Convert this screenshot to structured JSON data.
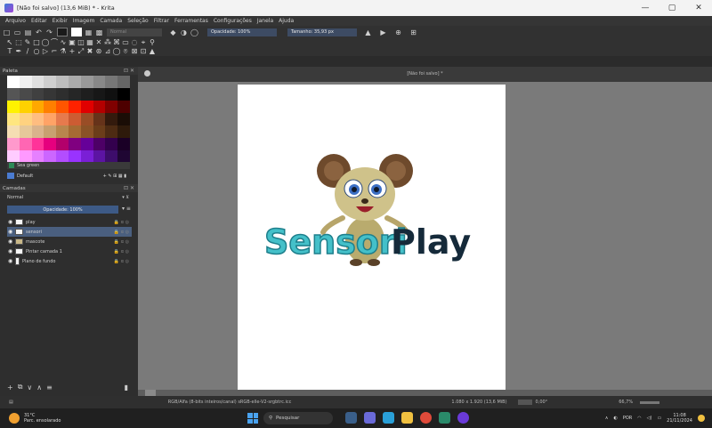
{
  "window": {
    "title": "[Não foi salvo]  (13,6 MiB)  * - Krita",
    "minimize": "—",
    "maximize": "▢",
    "close": "✕"
  },
  "menu": [
    "Arquivo",
    "Editar",
    "Exibir",
    "Imagem",
    "Camada",
    "Seleção",
    "Filtrar",
    "Ferramentas",
    "Configurações",
    "Janela",
    "Ajuda"
  ],
  "toolbar": {
    "blend_mode": "Normal",
    "opacity": "Opacidade: 100%",
    "size": "Tamanho: 35,93 px",
    "fg_color": "#1a1a1a",
    "bg_color": "#ffffff"
  },
  "tools_row1": [
    "↖",
    "⬚",
    "✎",
    "□",
    "◯",
    "⌒",
    "∿",
    "▣",
    "◫",
    "▦",
    "✕",
    "⁂",
    "⌘",
    "▭",
    "◌",
    "⌖",
    "⚲"
  ],
  "tools_row2": [
    "T",
    "✒",
    "/",
    "○",
    "▷",
    "⌐",
    "⚗",
    "+",
    "⤢",
    "✖",
    "⊛",
    "⊿",
    "◯",
    "⌾",
    "⊠",
    "⊡",
    "▲"
  ],
  "palette": {
    "title": "Paleta",
    "rows": [
      [
        "#ffffff",
        "#f0f0f0",
        "#e0e0e0",
        "#cfcfcf",
        "#bdbdbd",
        "#ababab",
        "#999999",
        "#888888",
        "#777777",
        "#666666"
      ],
      [
        "#555555",
        "#4a4a4a",
        "#404040",
        "#363636",
        "#2e2e2e",
        "#262626",
        "#1e1e1e",
        "#171717",
        "#101010",
        "#000000"
      ],
      [
        "#fff200",
        "#ffd100",
        "#ffa800",
        "#ff7f00",
        "#ff5500",
        "#ff2200",
        "#e00000",
        "#b30000",
        "#800000",
        "#4d0000"
      ],
      [
        "#ffe680",
        "#ffd280",
        "#ffbd80",
        "#ffa366",
        "#e67a4d",
        "#cc5c33",
        "#994d26",
        "#66331a",
        "#331a0d",
        "#1a0d06"
      ],
      [
        "#f5deb3",
        "#e6c89a",
        "#d9b38c",
        "#c8a070",
        "#b8864d",
        "#a66b33",
        "#8a5226",
        "#6b3d1a",
        "#4d2b13",
        "#2e1a0b"
      ],
      [
        "#ff99cc",
        "#ff66b3",
        "#ff3399",
        "#e6007e",
        "#b3006b",
        "#800080",
        "#660099",
        "#4d0066",
        "#33004d",
        "#1a0026"
      ],
      [
        "#ffccff",
        "#ff99ff",
        "#e680ff",
        "#cc66ff",
        "#b34dff",
        "#9933ff",
        "#7a1fd6",
        "#5c14a3",
        "#3d0d6b",
        "#1f0633"
      ]
    ],
    "selected_color_name": "Sea green",
    "palette_name": "Default"
  },
  "layers": {
    "title": "Camadas",
    "blend_mode": "Normal",
    "opacity": "Opacidade: 100%",
    "items": [
      {
        "name": "play",
        "active": false
      },
      {
        "name": "sensori",
        "active": true
      },
      {
        "name": "mascote",
        "active": false
      },
      {
        "name": "Pintar camada 1",
        "active": false
      },
      {
        "name": "Plano de fundo",
        "active": false
      }
    ]
  },
  "canvas": {
    "tab_title": "[Não foi salvo]  *",
    "logo": {
      "part1": "Sensori",
      "part2": "Play",
      "part1_color": "#44c0c9",
      "part2_color": "#152a3a"
    }
  },
  "statusbar": {
    "color_info": "RGB/Alfa (8-bits inteiros/canal)  sRGB-elle-V2-srgbtrc.icc",
    "size_info": "1.080 x 1.920 (13,6 MiB)",
    "rotation": "0,00°",
    "zoom": "66,7%"
  },
  "taskbar": {
    "weather_temp": "31°C",
    "weather_desc": "Parc. ensolarado",
    "search_label": "Pesquisar",
    "language": "POR",
    "time": "11:08",
    "date": "21/11/2024"
  }
}
